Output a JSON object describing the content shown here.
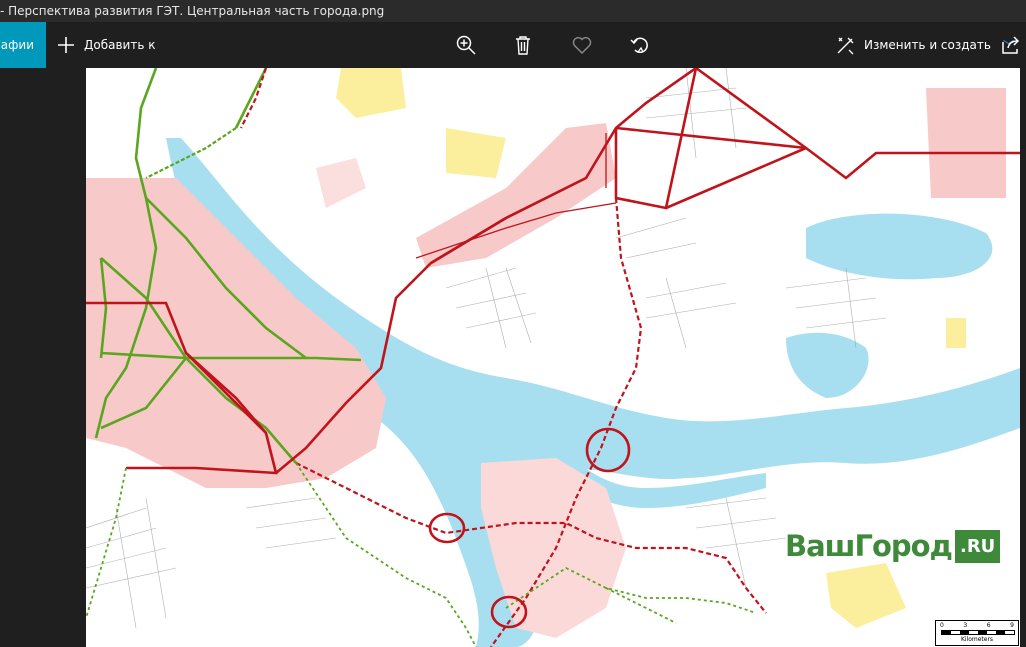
{
  "window": {
    "title": "- Перспектива развития ГЭТ. Центральная часть города.png"
  },
  "toolbar": {
    "photos_tab": "графии",
    "add_label": "Добавить к",
    "zoom_icon": "zoom-in-icon",
    "delete_icon": "trash-icon",
    "favorite_icon": "heart-icon",
    "rotate_icon": "rotate-icon",
    "edit_label": "Изменить и создать",
    "share_icon": "share-icon"
  },
  "watermark": {
    "name": "ВашГород",
    "tld": ".RU"
  },
  "scale": {
    "ticks": [
      "0",
      "3",
      "6",
      "9"
    ],
    "unit": "Kilometers"
  },
  "colors": {
    "accent": "#0099bc",
    "river": "#a8dff0",
    "residential": "#f7c9c9",
    "tram_existing": "#c0141c",
    "trolley_green": "#5aa61e",
    "industrial_yellow": "#fbef9d"
  }
}
